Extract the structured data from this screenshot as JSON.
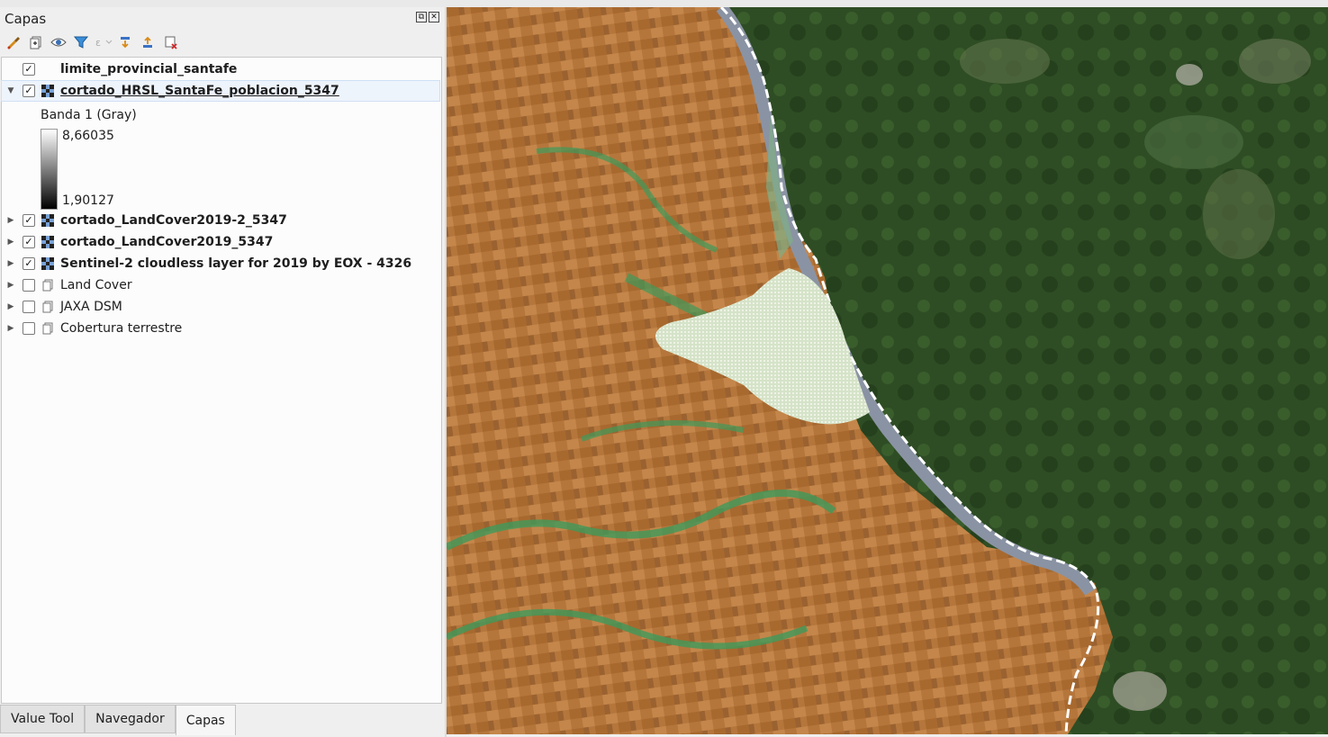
{
  "panel": {
    "title": "Capas",
    "float_glyph": "⧉",
    "close_glyph": "✕"
  },
  "toolbar": [
    {
      "name": "style-manager-icon",
      "glyph": "brush"
    },
    {
      "name": "add-group-icon",
      "glyph": "group"
    },
    {
      "name": "visibility-eye-icon",
      "glyph": "eye"
    },
    {
      "name": "filter-legend-icon",
      "glyph": "filter"
    },
    {
      "name": "filter-expression-icon",
      "glyph": "expr"
    },
    {
      "name": "expand-all-icon",
      "glyph": "expand"
    },
    {
      "name": "collapse-all-icon",
      "glyph": "collapse"
    },
    {
      "name": "remove-layer-icon",
      "glyph": "remove"
    }
  ],
  "layers": [
    {
      "name": "limite_provincial_santafe",
      "checked": true,
      "bold": true,
      "expander": "",
      "icon": "none"
    },
    {
      "name": "cortado_HRSL_SantaFe_poblacion_5347",
      "checked": true,
      "bold": true,
      "expander": "expanded",
      "icon": "raster",
      "selected": true
    },
    {
      "name": "cortado_LandCover2019-2_5347",
      "checked": true,
      "bold": true,
      "expander": "collapsed",
      "icon": "raster"
    },
    {
      "name": "cortado_LandCover2019_5347",
      "checked": true,
      "bold": true,
      "expander": "collapsed",
      "icon": "raster"
    },
    {
      "name": "Sentinel-2 cloudless layer for 2019 by EOX - 4326",
      "checked": true,
      "bold": true,
      "expander": "collapsed",
      "icon": "raster"
    },
    {
      "name": "Land Cover",
      "checked": false,
      "bold": false,
      "expander": "collapsed",
      "icon": "group"
    },
    {
      "name": "JAXA DSM",
      "checked": false,
      "bold": false,
      "expander": "collapsed",
      "icon": "group"
    },
    {
      "name": "Cobertura terrestre",
      "checked": false,
      "bold": false,
      "expander": "collapsed",
      "icon": "group"
    }
  ],
  "legend": {
    "band_label": "Banda 1 (Gray)",
    "max": "8,66035",
    "min": "1,90127"
  },
  "tabs": [
    {
      "label": "Value Tool",
      "active": false
    },
    {
      "label": "Navegador",
      "active": false
    },
    {
      "label": "Capas",
      "active": true
    }
  ],
  "colors": {
    "farmland": "#b5763c",
    "wetland": "#2c4a22",
    "urban": "#d9e6cf",
    "vegetation_class": "#3f9a5a",
    "river": "#8a93a3"
  }
}
